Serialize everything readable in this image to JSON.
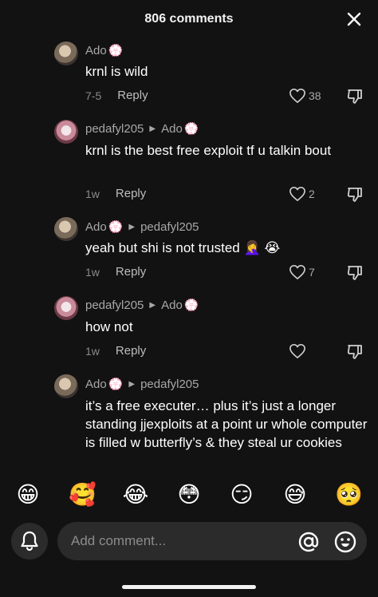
{
  "header": {
    "title": "806 comments"
  },
  "comments": [
    {
      "author": "Ado",
      "author_badge": "💮",
      "reply_to": "",
      "text": "krnl is wild",
      "date": "7-5",
      "reply_label": "Reply",
      "likes": "38"
    },
    {
      "author": "pedafyl205",
      "author_badge": "",
      "reply_to": "Ado",
      "reply_to_badge": "💮",
      "text": "krnl is the best free exploit tf u talkin bout",
      "date": "1w",
      "reply_label": "Reply",
      "likes": "2"
    },
    {
      "author": "Ado",
      "author_badge": "💮",
      "reply_to": "pedafyl205",
      "reply_to_badge": "",
      "text": "yeah but shi is not trusted 🤦‍♀️ 😭",
      "date": "1w",
      "reply_label": "Reply",
      "likes": "7"
    },
    {
      "author": "pedafyl205",
      "author_badge": "",
      "reply_to": "Ado",
      "reply_to_badge": "💮",
      "text": "how not",
      "date": "1w",
      "reply_label": "Reply",
      "likes": ""
    },
    {
      "author": "Ado",
      "author_badge": "💮",
      "reply_to": "pedafyl205",
      "reply_to_badge": "",
      "text": "it’s a free executer… plus it’s just a longer standing jjexploits at a point ur whole computer is filled w butterfly’s & they steal ur cookies"
    }
  ],
  "emoji_bar": [
    "😁",
    "🥰",
    "😂",
    "😳",
    "😏",
    "😅",
    "🥺"
  ],
  "input": {
    "placeholder": "Add comment..."
  }
}
